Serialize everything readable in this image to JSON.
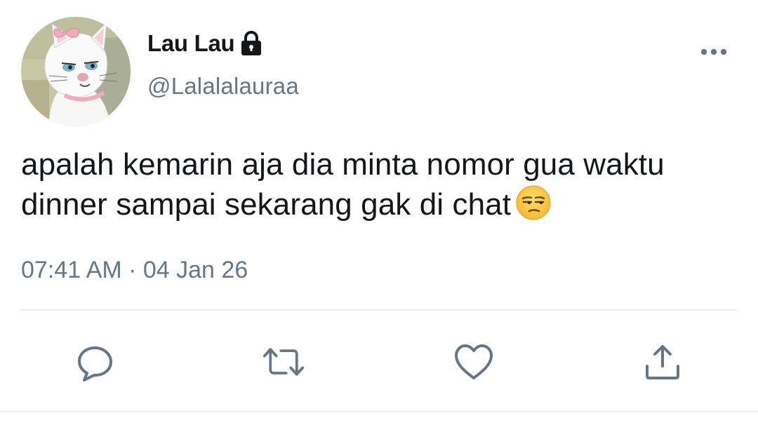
{
  "user": {
    "display_name": "Lau Lau",
    "username": "@Lalalalauraa",
    "protected_icon": "lock-icon",
    "avatar_icon": "cat-avatar"
  },
  "tweet": {
    "text": "apalah kemarin aja dia minta nomor gua waktu dinner sampai sekarang gak di chat",
    "emoji": "unamused-face",
    "time": "07:41 AM",
    "separator": " · ",
    "date": "04 Jan 26"
  },
  "menu": {
    "icon": "more-horizontal-icon"
  },
  "actions": [
    {
      "name": "reply",
      "icon": "reply-icon"
    },
    {
      "name": "retweet",
      "icon": "retweet-icon"
    },
    {
      "name": "like",
      "icon": "heart-icon"
    },
    {
      "name": "share",
      "icon": "share-icon"
    }
  ],
  "colors": {
    "text_primary": "#14171a",
    "text_secondary": "#657786",
    "icon": "#657786",
    "divider": "#e6ecf0"
  }
}
